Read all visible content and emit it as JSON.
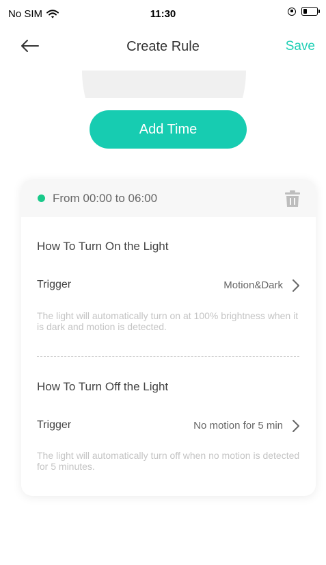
{
  "status_bar": {
    "carrier": "No SIM",
    "time": "11:30",
    "battery_level_percent": 25
  },
  "nav": {
    "title": "Create Rule",
    "save_label": "Save"
  },
  "add_time": {
    "label": "Add Time"
  },
  "rule": {
    "time_range": "From 00:00 to 06:00",
    "status_color": "#19c98a",
    "turn_on": {
      "title": "How To Turn On the Light",
      "trigger_label": "Trigger",
      "trigger_value": "Motion&Dark",
      "description": "The light will automatically turn on at 100% brightness when it is dark and motion is detected."
    },
    "turn_off": {
      "title": "How To Turn Off the Light",
      "trigger_label": "Trigger",
      "trigger_value": "No motion for 5 min",
      "description": "The light will automatically turn off when no motion is detected for 5 minutes."
    }
  },
  "colors": {
    "accent": "#17ccb1",
    "save_text": "#1ecfb5"
  }
}
